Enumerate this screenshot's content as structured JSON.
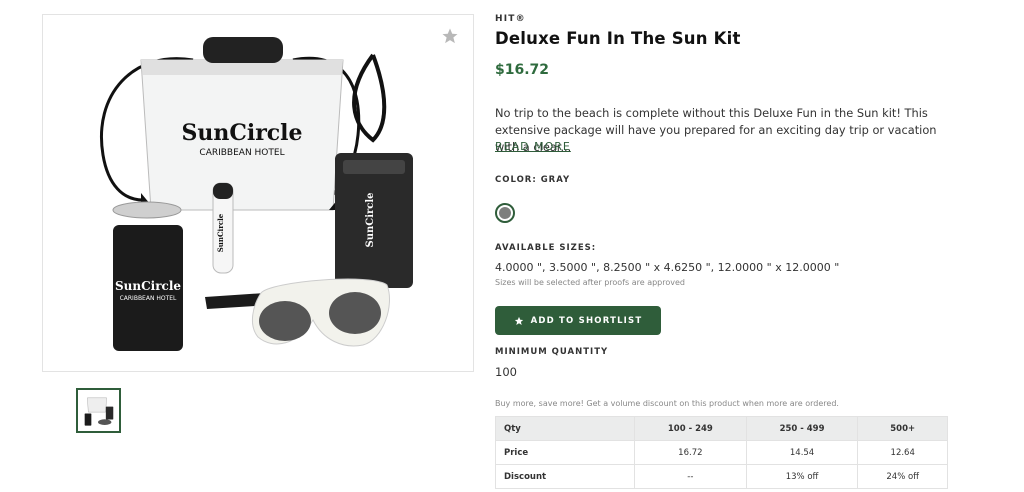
{
  "product": {
    "brand": "HIT®",
    "title": "Deluxe Fun In The Sun Kit",
    "price": "$16.72",
    "description": "No trip to the beach is complete without this Deluxe Fun in the Sun kit! This extensive package will have you prepared for an exciting day trip or vacation with a clear...",
    "read_more": "READ MORE",
    "color_label": "COLOR: GRAY",
    "selected_color": "#7d7f7d",
    "sizes_label": "AVAILABLE SIZES:",
    "sizes_value": "4.0000 \", 3.5000 \", 8.2500 \" x 4.6250 \", 12.0000 \" x 12.0000 \"",
    "sizes_note": "Sizes will be selected after proofs are approved",
    "shortlist_button": "ADD TO SHORTLIST",
    "min_qty_label": "MINIMUM QUANTITY",
    "min_qty_value": "100",
    "volume_note": "Buy more, save more! Get a volume discount on this product when more are ordered."
  },
  "imprint": {
    "brand_text": "SunCircle",
    "sub_text": "CARIBBEAN HOTEL"
  },
  "pricing": {
    "headers": [
      "Qty",
      "100 - 249",
      "250 - 499",
      "500+"
    ],
    "rows": [
      {
        "label": "Price",
        "values": [
          "16.72",
          "14.54",
          "12.64"
        ]
      },
      {
        "label": "Discount",
        "values": [
          "--",
          "13% off",
          "24% off"
        ]
      }
    ]
  },
  "colors": {
    "accent": "#2f5d3a",
    "price": "#2f6b3e"
  },
  "icons": {
    "favorite": "star-icon",
    "shortlist": "star-icon"
  }
}
